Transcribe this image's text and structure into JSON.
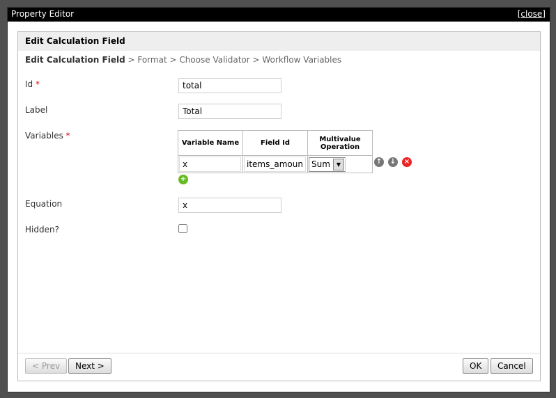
{
  "title": "Property Editor",
  "close": "[close]",
  "header": "Edit Calculation Field",
  "breadcrumb": {
    "current": "Edit Calculation Field",
    "rest": " > Format > Choose Validator > Workflow Variables"
  },
  "fields": {
    "id_label": "Id",
    "id_value": "total",
    "label_label": "Label",
    "label_value": "Total",
    "variables_label": "Variables",
    "equation_label": "Equation",
    "equation_value": "x",
    "hidden_label": "Hidden?",
    "required_mark": "*"
  },
  "table": {
    "headers": [
      "Variable Name",
      "Field Id",
      "Multivalue Operation"
    ],
    "rows": [
      {
        "name": "x",
        "field": "items_amount",
        "op": "Sum"
      }
    ]
  },
  "buttons": {
    "prev": "< Prev",
    "next": "Next >",
    "ok": "OK",
    "cancel": "Cancel"
  }
}
